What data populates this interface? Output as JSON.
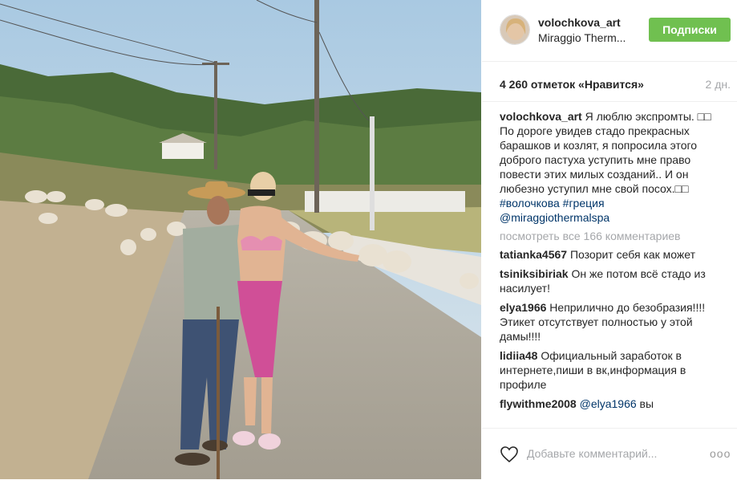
{
  "post": {
    "username": "volochkova_art",
    "location": "Miraggio Therm...",
    "follow_label": "Подписки",
    "likes_text": "4 260 отметок «Нравится»",
    "age": "2 дн."
  },
  "caption": {
    "author": "volochkova_art",
    "text_1": "Я люблю экспромты. □□ По дороге увидев стадо прекрасных барашков и козлят, я попросила этого доброго пастуха уступить мне право повести этих милых созданий.. И он любезно уступил мне свой посох.□□",
    "hashtags": "#волочкова #греция",
    "mention": "@miraggiothermalspa"
  },
  "view_all": "посмотреть все 166 комментариев",
  "comments": [
    {
      "author": "tatianka4567",
      "text": "Позорит себя как может"
    },
    {
      "author": "tsiniksibiriak",
      "text": "Он же потом всё стадо из насилует!"
    },
    {
      "author": "elya1966",
      "text": "Неприлично до безобразия!!!! Этикет отсутствует полностью у этой дамы!!!!"
    },
    {
      "author": "lidiia48",
      "text": "Официальный заработок в интернете,пиши в вк,информация в профиле"
    },
    {
      "author": "flywithme2008",
      "mention": "@elya1966",
      "text": "вы"
    }
  ],
  "footer": {
    "placeholder": "Добавьте комментарий...",
    "more": "ooo"
  },
  "colors": {
    "follow_button": "#70c050",
    "link": "#003569",
    "muted": "#a5a7aa"
  },
  "icons": {
    "like": "heart-outline-icon",
    "more": "ellipsis-icon"
  }
}
